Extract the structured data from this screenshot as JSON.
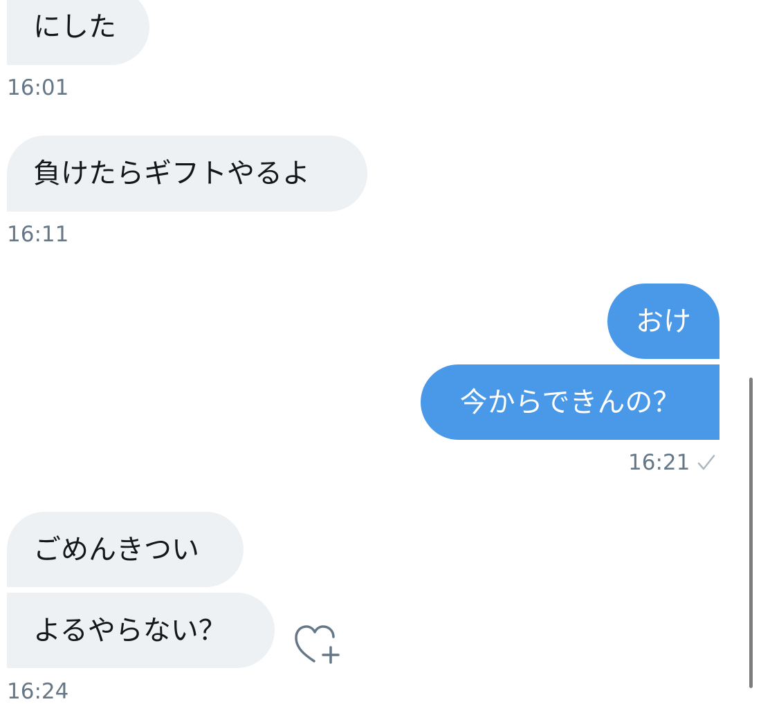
{
  "messages": [
    {
      "direction": "incoming",
      "text": "にした"
    },
    {
      "direction": "incoming",
      "text": "負けたらギフトやるよ"
    },
    {
      "direction": "outgoing",
      "text": "おけ"
    },
    {
      "direction": "outgoing",
      "text": "今からできんの？"
    },
    {
      "direction": "incoming",
      "text": "ごめんきつい"
    },
    {
      "direction": "incoming",
      "text": "よるやらない？"
    }
  ],
  "timestamps": {
    "t1": "16:01",
    "t2": "16:11",
    "t3": "16:21",
    "t4": "16:24"
  },
  "icons": {
    "read_receipt": "checkmark-icon",
    "react": "heart-plus-icon"
  },
  "colors": {
    "incoming_bubble": "#eef1f3",
    "outgoing_bubble": "#4a99e9",
    "timestamp": "#657786"
  }
}
